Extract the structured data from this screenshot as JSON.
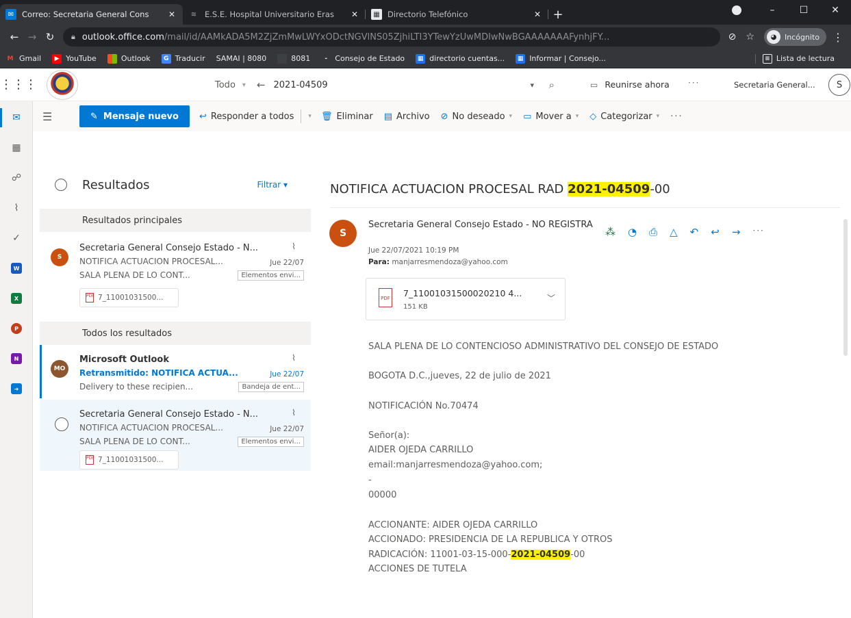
{
  "browser": {
    "tabs": [
      {
        "label": "Correo: Secretaria General Cons",
        "active": true
      },
      {
        "label": "E.S.E. Hospital Universitario Eras",
        "active": false
      },
      {
        "label": "Directorio Telefónico",
        "active": false
      }
    ],
    "url_host": "outlook.office.com",
    "url_path": "/mail/id/AAMkADA5M2ZjZmMwLWYxODctNGVlNS05ZjhiLTI3YTewYzUwMDIwNwBGAAAAAAAFynhjFY...",
    "incognito_label": "Incógnito",
    "bookmarks": [
      "Gmail",
      "YouTube",
      "Outlook",
      "Traducir",
      "SAMAI | 8080",
      "8081",
      "Consejo de Estado",
      "directorio cuentas...",
      "Informar | Consejo..."
    ],
    "reading_list": "Lista de lectura"
  },
  "header": {
    "search_scope": "Todo",
    "search_query": "2021-04509",
    "meet_now": "Reunirse ahora",
    "account_name": "Secretaria General...",
    "avatar_initial": "S"
  },
  "toolbar": {
    "new_message": "Mensaje nuevo",
    "reply_all": "Responder a todos",
    "delete": "Eliminar",
    "archive": "Archivo",
    "junk": "No deseado",
    "move_to": "Mover a",
    "categorize": "Categorizar"
  },
  "list": {
    "title": "Resultados",
    "filter": "Filtrar",
    "top_results": "Resultados principales",
    "all_results": "Todos los resultados",
    "messages": [
      {
        "initials": "S",
        "from": "Secretaria General Consejo Estado - N...",
        "subject": "NOTIFICA ACTUACION PROCESAL...",
        "date": "Jue 22/07",
        "preview": "SALA PLENA DE LO CONT...",
        "folder": "Elementos envi...",
        "attachment": "7_11001031500..."
      },
      {
        "initials": "MO",
        "from": "Microsoft Outlook",
        "subject": "Retransmitido: NOTIFICA ACTUA...",
        "date": "Jue 22/07",
        "preview": "Delivery to these recipien...",
        "folder": "Bandeja de ent..."
      },
      {
        "from": "Secretaria General Consejo Estado - N...",
        "subject": "NOTIFICA ACTUACION PROCESAL...",
        "date": "Jue 22/07",
        "preview": "SALA PLENA DE LO CONT...",
        "folder": "Elementos envi...",
        "attachment": "7_11001031500..."
      }
    ]
  },
  "reading": {
    "subject_pre": "NOTIFICA ACTUACION PROCESAL RAD ",
    "subject_hl": "2021-04509",
    "subject_post": "-00",
    "sender_initial": "S",
    "sender": "Secretaria General Consejo Estado - NO REGISTRA",
    "date": "Jue 22/07/2021 10:19 PM",
    "to_label": "Para:",
    "to": "manjarresmendoza@yahoo.com",
    "attachment_name": "7_11001031500020210 4...",
    "attachment_size": "151 KB",
    "body": {
      "l1": "SALA PLENA DE LO CONTENCIOSO ADMINISTRATIVO DEL CONSEJO DE ESTADO",
      "l2": "BOGOTA D.C.,jueves, 22 de julio de 2021",
      "l3": "NOTIFICACIÓN No.70474",
      "l4": "Señor(a):",
      "l5": "AIDER OJEDA CARRILLO",
      "l6": "email:manjarresmendoza@yahoo.com;",
      "l7": "-",
      "l8": "00000",
      "l9": "ACCIONANTE: AIDER OJEDA CARRILLO",
      "l10": "ACCIONADO: PRESIDENCIA DE LA REPUBLICA Y OTROS",
      "l11_pre": "RADICACIÓN: 11001-03-15-000-",
      "l11_hl": "2021-04509",
      "l11_post": "-00",
      "l12": "ACCIONES DE TUTELA"
    }
  }
}
